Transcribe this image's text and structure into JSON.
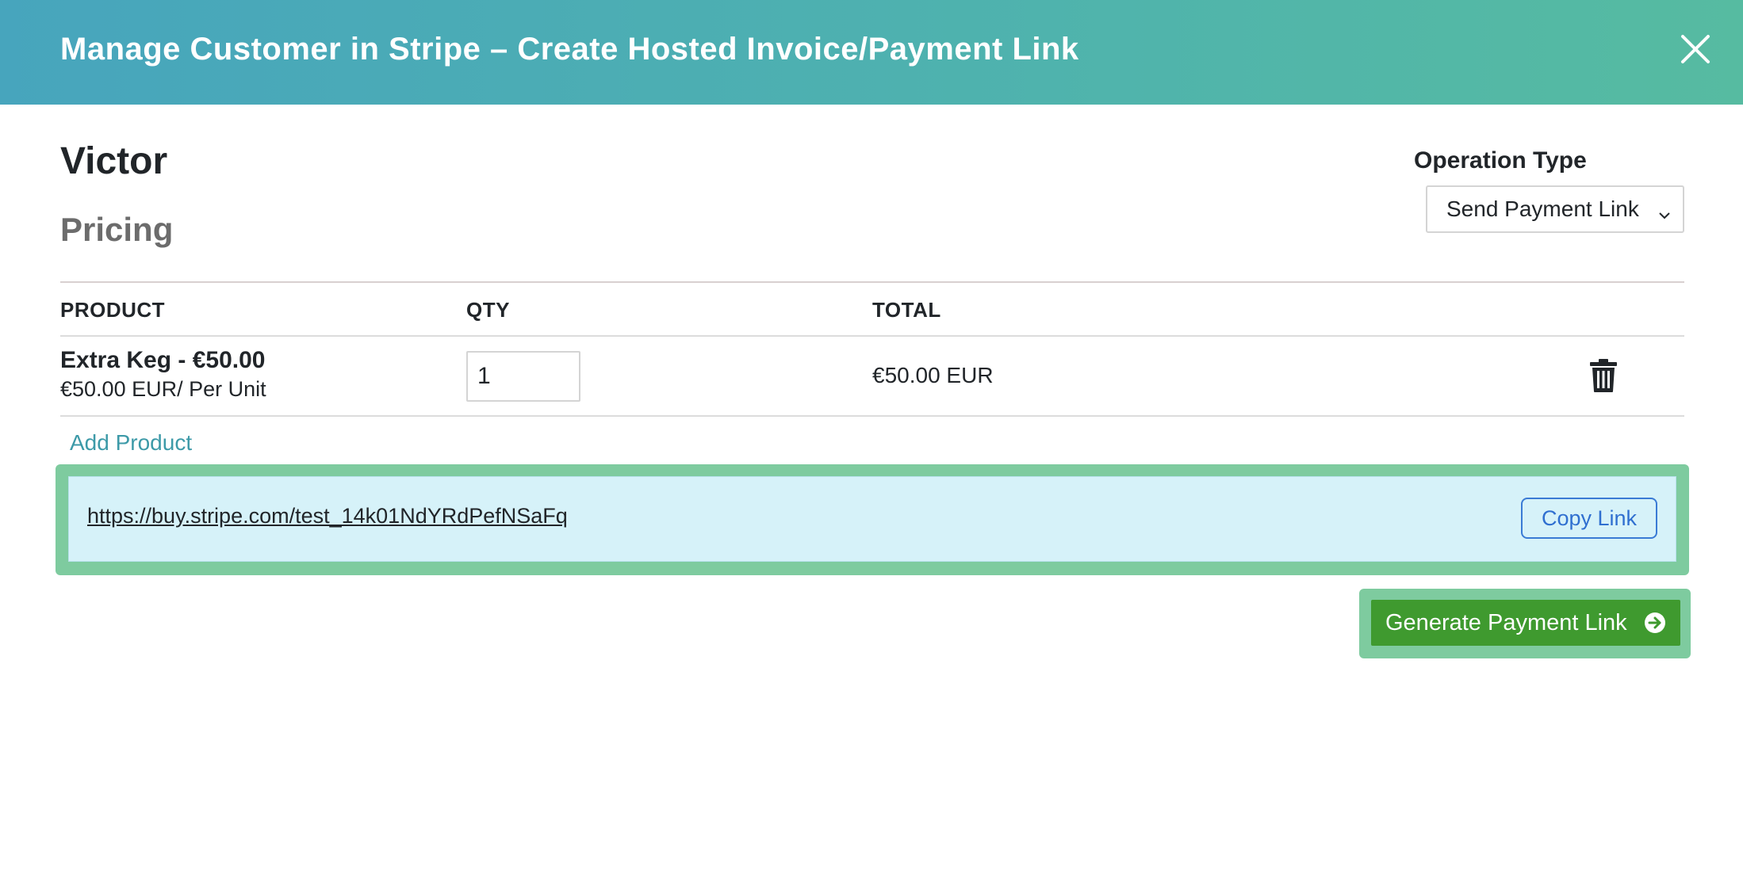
{
  "modal": {
    "title": "Manage Customer in Stripe – Create Hosted Invoice/Payment Link",
    "close_icon": "close-icon"
  },
  "customer": {
    "name": "Victor"
  },
  "pricing": {
    "section_title": "Pricing"
  },
  "operation_type": {
    "label": "Operation Type",
    "selected": "Send Payment Link"
  },
  "table": {
    "headers": {
      "product": "PRODUCT",
      "qty": "QTY",
      "total": "TOTAL"
    },
    "rows": [
      {
        "product_name": "Extra Keg - €50.00",
        "unit_price": "€50.00 EUR/ Per Unit",
        "qty": "1",
        "total": "€50.00 EUR",
        "delete_icon": "trash-icon"
      }
    ]
  },
  "add_product_label": "Add Product",
  "payment_link": {
    "url": "https://buy.stripe.com/test_14k01NdYRdPefNSaFq",
    "copy_label": "Copy Link"
  },
  "generate": {
    "label": "Generate Payment Link",
    "icon": "arrow-circle-right-icon"
  },
  "colors": {
    "header_start": "#47a5bd",
    "header_end": "#56bba1",
    "highlight": "#7ecb9f",
    "link_box_bg": "#d6f2f9",
    "generate_button": "#3f9a2f",
    "copy_button": "#2f6fd0",
    "add_product_link": "#3d9aa8"
  }
}
